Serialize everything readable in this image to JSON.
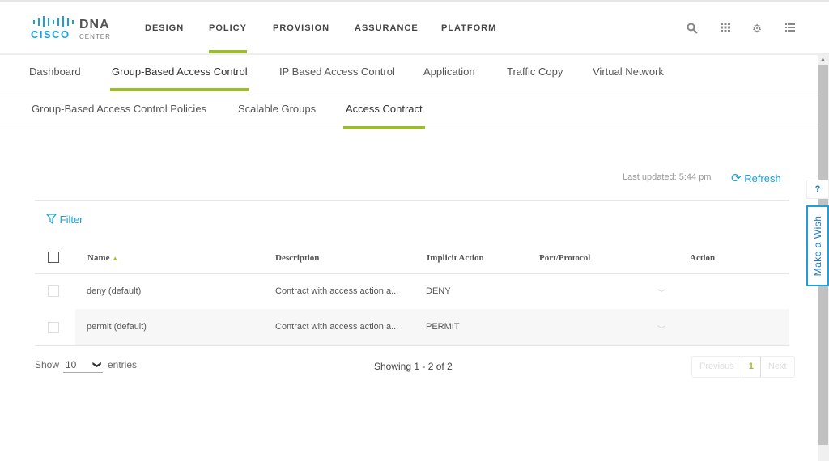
{
  "header": {
    "logo_text": "CISCO",
    "product": "DNA",
    "product_sub": "CENTER",
    "nav": [
      "DESIGN",
      "POLICY",
      "PROVISION",
      "ASSURANCE",
      "PLATFORM"
    ],
    "active_nav": "POLICY",
    "icons": [
      "search-icon",
      "apps-grid-icon",
      "gear-icon",
      "list-icon"
    ]
  },
  "tabs": [
    "Dashboard",
    "Group-Based Access Control",
    "IP Based Access Control",
    "Application",
    "Traffic Copy",
    "Virtual Network"
  ],
  "subtabs": [
    "Group-Based Access Control Policies",
    "Scalable Groups",
    "Access Contract"
  ],
  "toolbar": {
    "last_updated": "Last updated: 5:44 pm",
    "refresh": "Refresh",
    "filter": "Filter"
  },
  "table": {
    "columns": [
      "Name",
      "Description",
      "Implicit Action",
      "Port/Protocol",
      "Action"
    ],
    "rows": [
      {
        "name": "deny (default)",
        "description": "Contract with access action a...",
        "implicit_action": "DENY",
        "port_protocol": ""
      },
      {
        "name": "permit (default)",
        "description": "Contract with access action a...",
        "implicit_action": "PERMIT",
        "port_protocol": ""
      }
    ]
  },
  "footer": {
    "show": "Show",
    "page_size": "10",
    "entries": "entries",
    "showing": "Showing 1 - 2 of 2",
    "previous": "Previous",
    "page": "1",
    "next": "Next"
  },
  "side": {
    "help": "?",
    "wish": "Make a Wish"
  },
  "colors": {
    "accent": "#9dbb2f",
    "link": "#1ba0d7"
  }
}
